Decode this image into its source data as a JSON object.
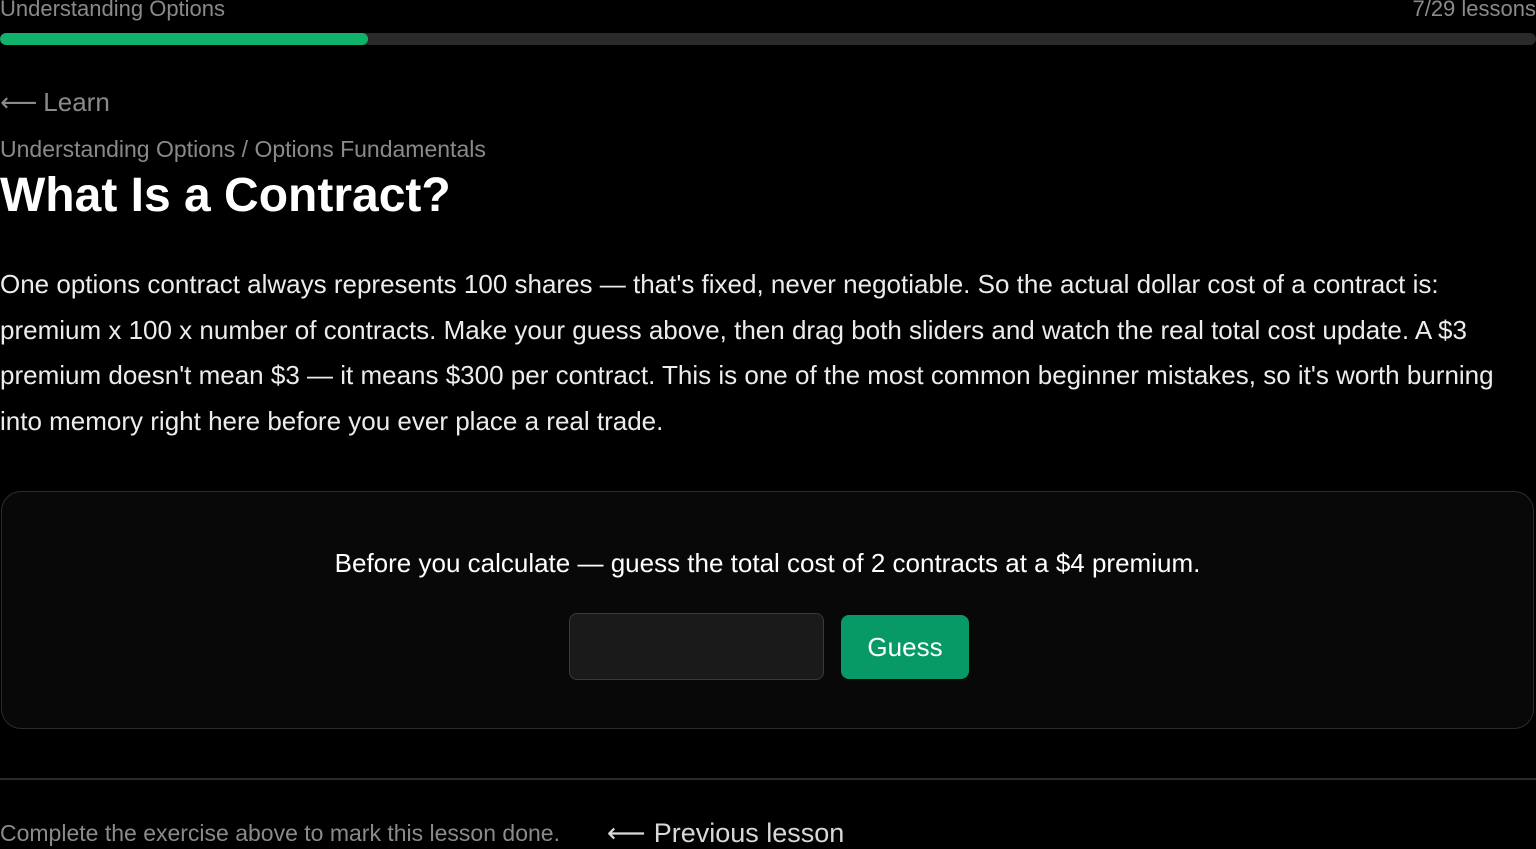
{
  "header": {
    "course_title": "Understanding Options",
    "lesson_count": "7/29 lessons",
    "progress_fraction": 0.2393,
    "progress_color": "#10b26c"
  },
  "nav": {
    "back_arrow": "⟵",
    "back_label": "Learn"
  },
  "breadcrumb": {
    "course": "Understanding Options",
    "separator": "/",
    "module": "Options Fundamentals"
  },
  "lesson": {
    "title": "What Is a Contract?",
    "body": "One options contract always represents 100 shares — that's fixed, never negotiable. So the actual dollar cost of a contract is: premium x 100 x number of contracts. Make your guess above, then drag both sliders and watch the real total cost update. A $3 premium doesn't mean $3 — it means $300 per contract. This is one of the most common beginner mistakes, so it's worth burning into memory right here before you ever place a real trade."
  },
  "exercise": {
    "prompt": "Before you calculate — guess the total cost of 2 contracts at a $4 premium.",
    "input_value": "",
    "input_placeholder": "",
    "button_label": "Guess",
    "button_color": "#079a66"
  },
  "footer": {
    "completion_note": "Complete the exercise above to mark this lesson done.",
    "prev_arrow": "⟵",
    "prev_label": "Previous lesson"
  }
}
